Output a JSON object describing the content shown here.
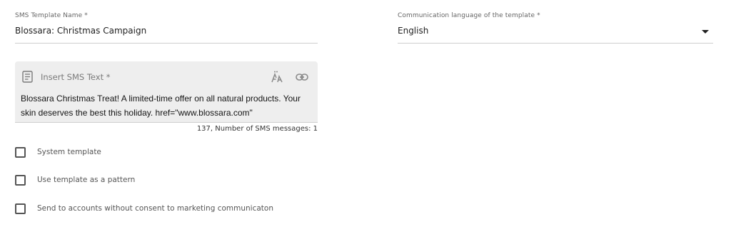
{
  "template_name": {
    "label": "SMS Template Name",
    "required_mark": "*",
    "value": "Blossara: Christmas Campaign"
  },
  "language": {
    "label": "Communication language of the template",
    "required_mark": "*",
    "value": "English",
    "icon": "caret-down-icon"
  },
  "sms_text": {
    "label": "Insert SMS Text",
    "required_mark": "*",
    "value": "Blossara Christmas Treat! A limited-time offer on all natural products. Your skin deserves the best this holiday. href=\"www.blossara.com\"",
    "icons": [
      "text-document-icon",
      "personalization-icon",
      "link-icon"
    ],
    "counter": "137, Number of SMS messages: 1"
  },
  "options": [
    {
      "label": "System template",
      "checked": false
    },
    {
      "label": "Use template as a pattern",
      "checked": false
    },
    {
      "label": "Send to accounts without consent to marketing communicaton",
      "checked": false
    }
  ],
  "colors": {
    "text_area_background": "#eeeeee",
    "underline": "#cfcfcf",
    "label": "#666666"
  }
}
